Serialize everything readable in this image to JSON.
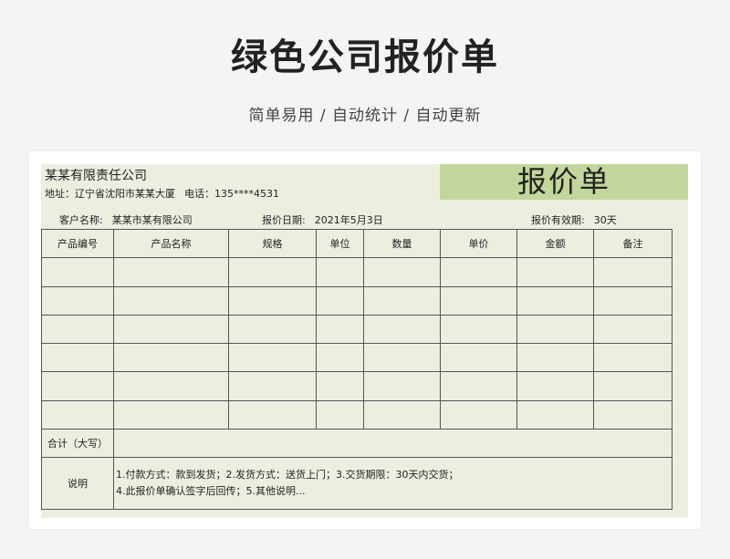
{
  "page": {
    "title": "绿色公司报价单",
    "subtitle": "简单易用 / 自动统计 / 自动更新"
  },
  "quote": {
    "company": "某某有限责任公司",
    "address_label": "地址：辽宁省沈阳市某某大厦",
    "phone_label": "电话：135****4531",
    "banner": "报价单",
    "customer_label": "客户名称:",
    "customer_value": "某某市某有限公司",
    "date_label": "报价日期:",
    "date_value": "2021年5月3日",
    "valid_label": "报价有效期:",
    "valid_value": "30天",
    "columns": [
      "产品编号",
      "产品名称",
      "规格",
      "单位",
      "数量",
      "单价",
      "金额",
      "备注"
    ],
    "total_label": "合计（大写）",
    "notes_label": "说明",
    "notes_line1": "1.付款方式：款到发货；2.发货方式：送货上门；3.交货期限：30天内交货；",
    "notes_line2": "4.此报价单确认签字后回传；5.其他说明..."
  }
}
